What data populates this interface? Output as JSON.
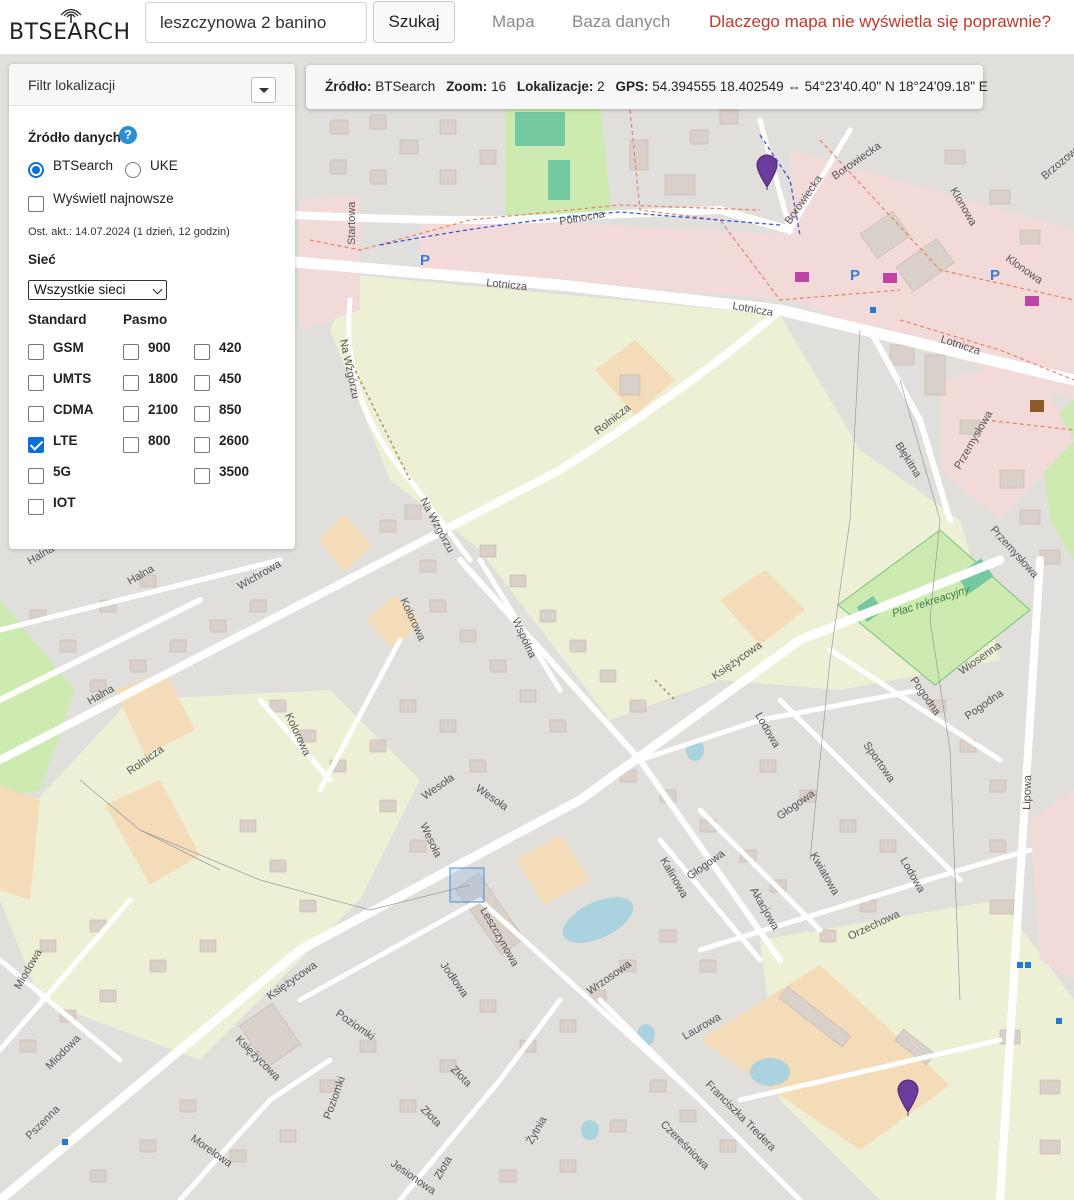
{
  "header": {
    "logo_text": "BTSEARCH",
    "search_value": "leszczynowa 2 banino",
    "search_button": "Szukaj",
    "nav": [
      "Mapa",
      "Baza danych",
      "Dlaczego mapa nie wyświetla się poprawnie?"
    ]
  },
  "infobar": {
    "source_label": "Źródło:",
    "source_value": "BTSearch",
    "zoom_label": "Zoom:",
    "zoom_value": "16",
    "locations_label": "Lokalizacje:",
    "locations_value": "2",
    "gps_label": "GPS:",
    "gps_value": "54.394555 18.402549 ⇔ 54°23'40.40\" N 18°24'09.18\" E"
  },
  "filter": {
    "title": "Filtr lokalizacji",
    "data_source_label": "Źródło danych",
    "help_icon": "?",
    "sources": [
      {
        "label": "BTSearch",
        "selected": true
      },
      {
        "label": "UKE",
        "selected": false
      }
    ],
    "show_newest_label": "Wyświetl najnowsze",
    "show_newest_checked": false,
    "last_update": "Ost. akt.: 14.07.2024 (1 dzień, 12 godzin)",
    "network_label": "Sieć",
    "network_selected": "Wszystkie sieci",
    "standard_label": "Standard",
    "band_label": "Pasmo",
    "standards": [
      {
        "label": "GSM",
        "checked": false
      },
      {
        "label": "UMTS",
        "checked": false
      },
      {
        "label": "CDMA",
        "checked": false
      },
      {
        "label": "LTE",
        "checked": true
      },
      {
        "label": "5G",
        "checked": false
      },
      {
        "label": "IOT",
        "checked": false
      }
    ],
    "bands_col1": [
      {
        "label": "900",
        "checked": false
      },
      {
        "label": "1800",
        "checked": false
      },
      {
        "label": "2100",
        "checked": false
      },
      {
        "label": "800",
        "checked": false
      }
    ],
    "bands_col2": [
      {
        "label": "420",
        "checked": false
      },
      {
        "label": "450",
        "checked": false
      },
      {
        "label": "850",
        "checked": false
      },
      {
        "label": "2600",
        "checked": false
      },
      {
        "label": "3500",
        "checked": false
      }
    ]
  },
  "map": {
    "streets": [
      "Północna",
      "Lotnicza",
      "Rolnicza",
      "Na Wzgórzu",
      "Wichrowa",
      "Kolorowa",
      "Wspólna",
      "Halna",
      "Wesoła",
      "Leszczynowa",
      "Księżycowa",
      "Jodłowa",
      "Wrzosowa",
      "Kalinowa",
      "Głogowa",
      "Akacjowa",
      "Kwiatowa",
      "Lodowa",
      "Sportowa",
      "Pogodna",
      "Wiosenna",
      "Orzechowa",
      "Laurowa",
      "Franciszka Tredera",
      "Czereśniowa",
      "Żytnia",
      "Złota",
      "Poziomki",
      "Miodowa",
      "Pszenna",
      "Jesionowa",
      "Morelowa",
      "Lipowa",
      "Błękitna",
      "Przemysłowa",
      "Borowiecka",
      "Klonowa",
      "Brzozowa",
      "Startowa"
    ],
    "park_label": "Plac rekreacyjny",
    "markers": 2,
    "colors": {
      "road": "#ffffff",
      "residential": "#e0dfdf",
      "field": "#eef0d5",
      "orange": "#f4d8b8",
      "green": "#cdebb0",
      "marker": "#6b3b9e"
    }
  }
}
